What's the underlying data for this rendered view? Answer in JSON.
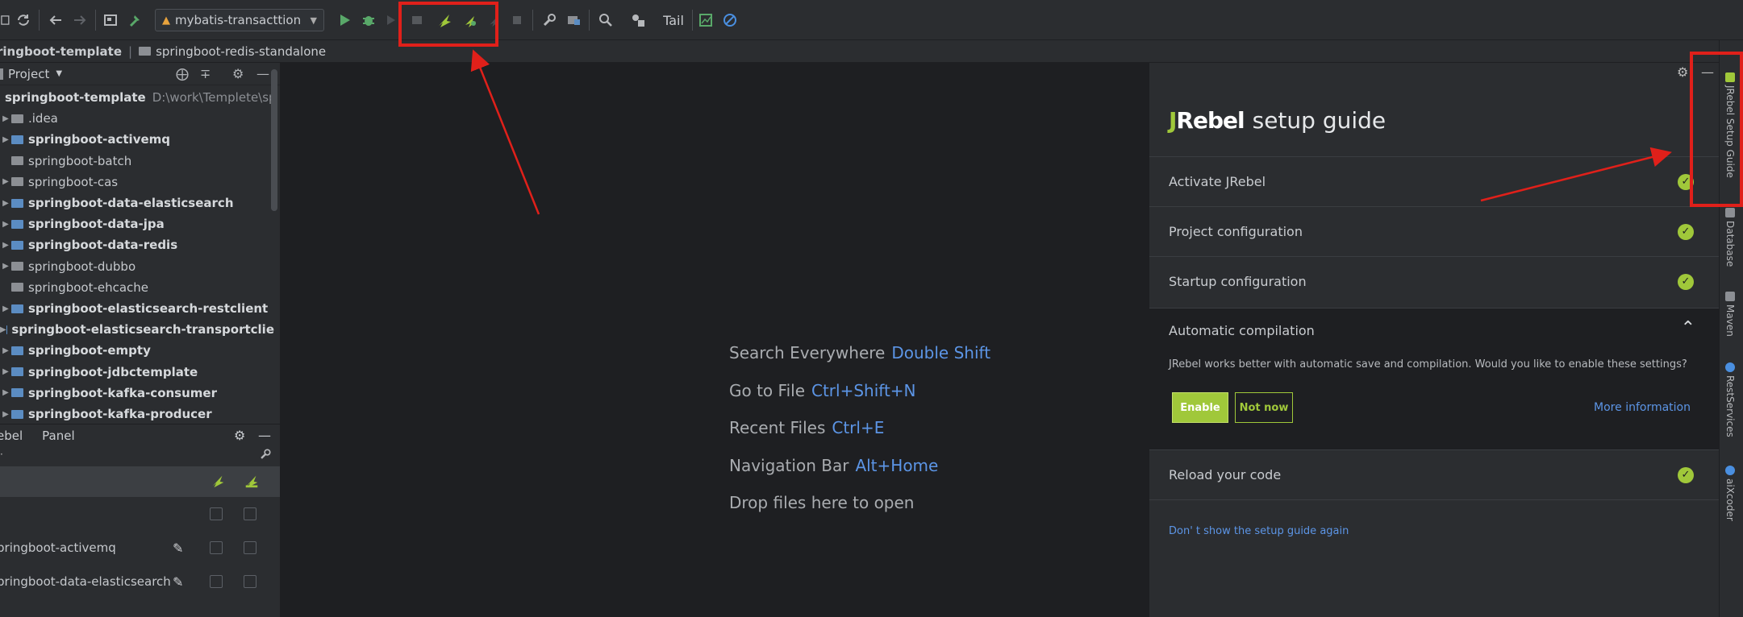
{
  "toolbar": {
    "run_config": "mybatis-transacttion",
    "tail_label": "Tail"
  },
  "breadcrumb": {
    "project": "ringboot-template",
    "module": "springboot-redis-standalone"
  },
  "project_panel": {
    "header_label": "Project",
    "tree": [
      {
        "label": "springboot-template",
        "path": "D:\\work\\Templete\\sp",
        "bold": true,
        "arrow": "",
        "icon": "module",
        "indent": 0
      },
      {
        "label": ".idea",
        "bold": false,
        "arrow": "▶",
        "icon": "folder",
        "indent": 1
      },
      {
        "label": "springboot-activemq",
        "bold": true,
        "arrow": "▶",
        "icon": "module",
        "indent": 1
      },
      {
        "label": "springboot-batch",
        "bold": false,
        "arrow": "",
        "icon": "folder",
        "indent": 1
      },
      {
        "label": "springboot-cas",
        "bold": false,
        "arrow": "▶",
        "icon": "folder",
        "indent": 1
      },
      {
        "label": "springboot-data-elasticsearch",
        "bold": true,
        "arrow": "▶",
        "icon": "module",
        "indent": 1
      },
      {
        "label": "springboot-data-jpa",
        "bold": true,
        "arrow": "▶",
        "icon": "module",
        "indent": 1
      },
      {
        "label": "springboot-data-redis",
        "bold": true,
        "arrow": "▶",
        "icon": "module",
        "indent": 1
      },
      {
        "label": "springboot-dubbo",
        "bold": false,
        "arrow": "▶",
        "icon": "folder",
        "indent": 1
      },
      {
        "label": "springboot-ehcache",
        "bold": false,
        "arrow": "",
        "icon": "folder",
        "indent": 1
      },
      {
        "label": "springboot-elasticsearch-restclient",
        "bold": true,
        "arrow": "▶",
        "icon": "module",
        "indent": 1
      },
      {
        "label": "springboot-elasticsearch-transportclie",
        "bold": true,
        "arrow": "▶",
        "icon": "module",
        "indent": 1
      },
      {
        "label": "springboot-empty",
        "bold": true,
        "arrow": "▶",
        "icon": "module",
        "indent": 1
      },
      {
        "label": "springboot-jdbctemplate",
        "bold": true,
        "arrow": "▶",
        "icon": "module",
        "indent": 1
      },
      {
        "label": "springboot-kafka-consumer",
        "bold": true,
        "arrow": "▶",
        "icon": "module",
        "indent": 1
      },
      {
        "label": "springboot-kafka-producer",
        "bold": true,
        "arrow": "▶",
        "icon": "module",
        "indent": 1
      }
    ]
  },
  "jrebel_panel": {
    "tabs": [
      "ebel",
      "Panel"
    ],
    "rows": [
      "",
      "pringboot-activemq",
      "pringboot-data-elasticsearch"
    ]
  },
  "editor": {
    "hints": [
      {
        "text": "Search Everywhere",
        "key": "Double Shift"
      },
      {
        "text": "Go to File",
        "key": "Ctrl+Shift+N"
      },
      {
        "text": "Recent Files",
        "key": "Ctrl+E"
      },
      {
        "text": "Navigation Bar",
        "key": "Alt+Home"
      },
      {
        "text": "Drop files here to open",
        "key": ""
      }
    ]
  },
  "guide": {
    "brand": "Rebel",
    "brand_j": "J",
    "title": "setup guide",
    "steps": [
      "Activate JRebel",
      "Project configuration",
      "Startup configuration"
    ],
    "auto": {
      "title": "Automatic compilation",
      "description": "JRebel works better with automatic save and compilation. Would you like to enable these settings?",
      "enable": "Enable",
      "not_now": "Not now",
      "more_info": "More information"
    },
    "reload": "Reload your code",
    "dont_show": "Don' t show the setup guide again"
  },
  "stripe": {
    "tabs": [
      "JRebel Setup Guide",
      "Database",
      "Maven",
      "RestServices",
      "aiXcoder"
    ]
  },
  "colors": {
    "accent_green": "#a0c83a",
    "link_blue": "#5c95e6",
    "annotation_red": "#e0201a"
  }
}
